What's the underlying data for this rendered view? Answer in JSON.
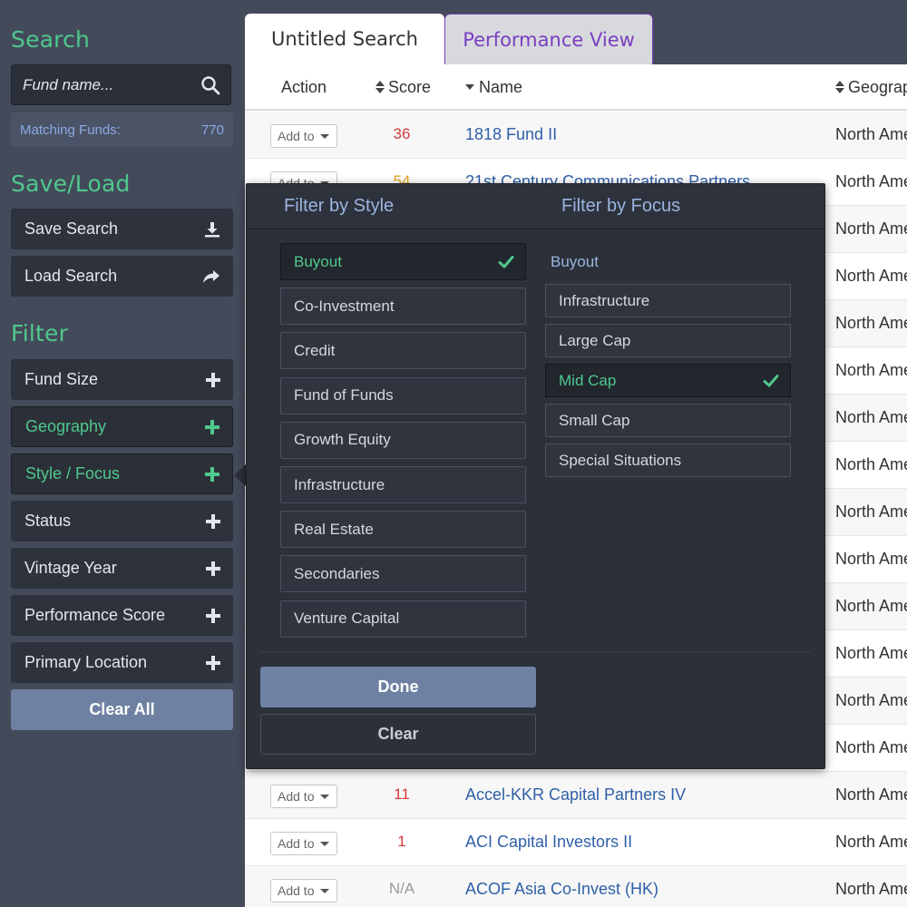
{
  "sidebar": {
    "search_title": "Search",
    "search_placeholder": "Fund name...",
    "matching_label": "Matching Funds:",
    "matching_count": "770",
    "saveload_title": "Save/Load",
    "save_label": "Save Search",
    "load_label": "Load Search",
    "filter_title": "Filter",
    "filters": [
      {
        "label": "Fund Size",
        "active": false
      },
      {
        "label": "Geography",
        "active": true
      },
      {
        "label": "Style / Focus",
        "active": true
      },
      {
        "label": "Status",
        "active": false
      },
      {
        "label": "Vintage Year",
        "active": false
      },
      {
        "label": "Performance Score",
        "active": false
      },
      {
        "label": "Primary Location",
        "active": false
      }
    ],
    "clear_all": "Clear All"
  },
  "tabs": [
    {
      "label": "Untitled Search",
      "active": true
    },
    {
      "label": "Performance View",
      "active": false
    }
  ],
  "table": {
    "headers": {
      "action": "Action",
      "score": "Score",
      "name": "Name",
      "geography": "Geograp"
    },
    "add_label": "Add to",
    "rows": [
      {
        "score": "36",
        "score_color": "#d23b3b",
        "name": "1818 Fund II",
        "geo": "North Ame"
      },
      {
        "score": "54",
        "score_color": "#e8a020",
        "name": "21st Century Communications Partners",
        "geo": "North Ame"
      },
      {
        "score": "",
        "score_color": "#d23b3b",
        "name": "",
        "geo": "North Ame"
      },
      {
        "score": "",
        "score_color": "#d23b3b",
        "name": "",
        "geo": "North Ame"
      },
      {
        "score": "",
        "score_color": "#d23b3b",
        "name": "",
        "geo": "North Ame"
      },
      {
        "score": "",
        "score_color": "#d23b3b",
        "name": "",
        "geo": "North Ame"
      },
      {
        "score": "",
        "score_color": "#d23b3b",
        "name": "",
        "geo": "North Ame"
      },
      {
        "score": "",
        "score_color": "#d23b3b",
        "name": "",
        "geo": "North Ame"
      },
      {
        "score": "",
        "score_color": "#d23b3b",
        "name": "",
        "geo": "North Ame"
      },
      {
        "score": "",
        "score_color": "#d23b3b",
        "name": "",
        "geo": "North Ame"
      },
      {
        "score": "",
        "score_color": "#d23b3b",
        "name": "",
        "geo": "North Ame"
      },
      {
        "score": "",
        "score_color": "#d23b3b",
        "name": "",
        "geo": "North Ame"
      },
      {
        "score": "",
        "score_color": "#d23b3b",
        "name": "",
        "geo": "North Ame"
      },
      {
        "score": "",
        "score_color": "#d23b3b",
        "name": "",
        "geo": "North Ame"
      },
      {
        "score": "11",
        "score_color": "#d23b3b",
        "name": "Accel-KKR Capital Partners IV",
        "geo": "North Ame"
      },
      {
        "score": "1",
        "score_color": "#d23b3b",
        "name": "ACI Capital Investors II",
        "geo": "North Ame"
      },
      {
        "score": "N/A",
        "score_color": "#9a9a9a",
        "name": "ACOF Asia Co-Invest (HK)",
        "geo": "North Ame"
      }
    ]
  },
  "popup": {
    "style_title": "Filter by Style",
    "focus_title": "Filter by Focus",
    "styles": [
      {
        "label": "Buyout",
        "selected": true
      },
      {
        "label": "Co-Investment",
        "selected": false
      },
      {
        "label": "Credit",
        "selected": false
      },
      {
        "label": "Fund of Funds",
        "selected": false
      },
      {
        "label": "Growth Equity",
        "selected": false
      },
      {
        "label": "Infrastructure",
        "selected": false
      },
      {
        "label": "Real Estate",
        "selected": false
      },
      {
        "label": "Secondaries",
        "selected": false
      },
      {
        "label": "Venture Capital",
        "selected": false
      }
    ],
    "focus_group": "Buyout",
    "focuses": [
      {
        "label": "Infrastructure",
        "selected": false
      },
      {
        "label": "Large Cap",
        "selected": false
      },
      {
        "label": "Mid Cap",
        "selected": true
      },
      {
        "label": "Small Cap",
        "selected": false
      },
      {
        "label": "Special Situations",
        "selected": false
      }
    ],
    "done_label": "Done",
    "clear_label": "Clear"
  },
  "colors": {
    "accent_green": "#4fc88d",
    "link_blue": "#2f5fa8",
    "sidebar_bg": "#434a5a",
    "button_blue": "#6f81a3"
  },
  "icons": [
    "search-icon",
    "download-icon",
    "share-arrow-icon",
    "plus-icon",
    "checkmark-icon",
    "sort-icon",
    "caret-down-icon"
  ]
}
